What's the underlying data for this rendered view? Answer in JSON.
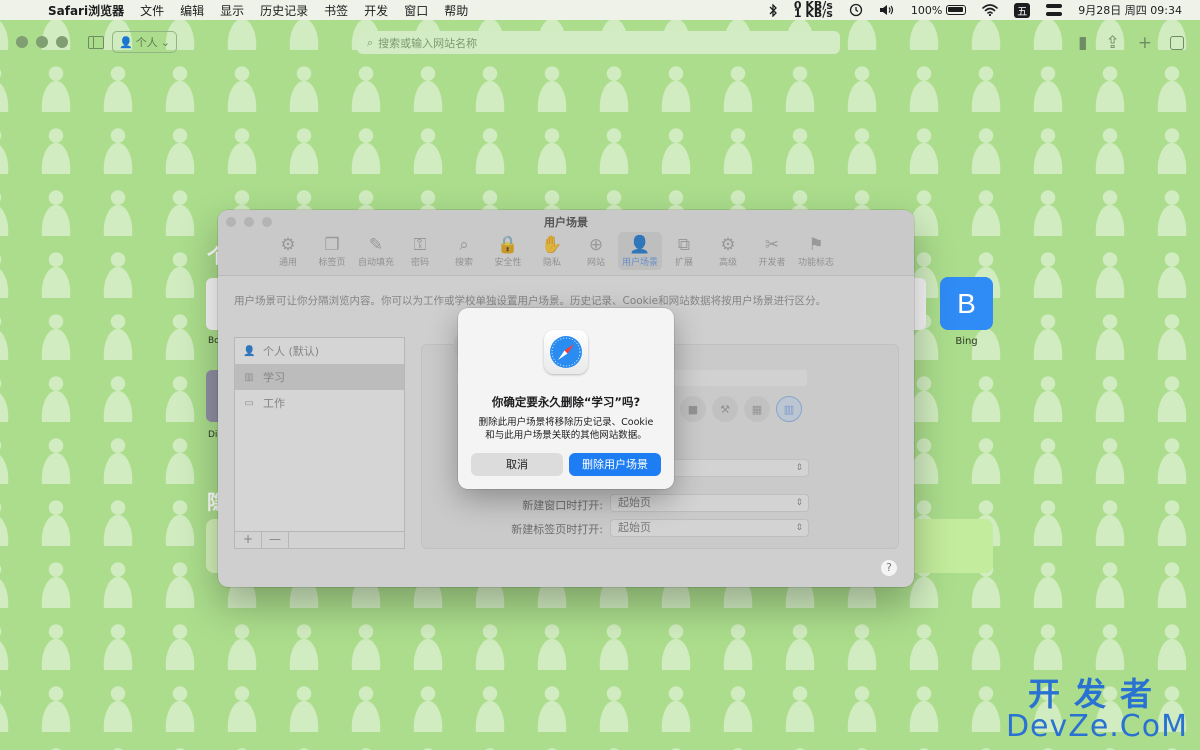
{
  "menubar": {
    "apple_glyph": "",
    "items": [
      "Safari浏览器",
      "文件",
      "编辑",
      "显示",
      "历史记录",
      "书签",
      "开发",
      "窗口",
      "帮助"
    ],
    "net_up": "0 KB/s",
    "net_down": "1 KB/s",
    "battery": "100%",
    "ime": "五",
    "datetime": "9月28日 周四  09:34"
  },
  "toolbar": {
    "profile_label": "个人",
    "address_placeholder": "搜索或输入网站名称"
  },
  "start_page": {
    "bing_letter": "B",
    "bing_label": "Bing"
  },
  "settings": {
    "title": "用户场景",
    "tabs": [
      {
        "label": "通用",
        "icon": "⚙"
      },
      {
        "label": "标签页",
        "icon": "❐"
      },
      {
        "label": "自动填充",
        "icon": "✎"
      },
      {
        "label": "密码",
        "icon": "⚿"
      },
      {
        "label": "搜索",
        "icon": "⌕"
      },
      {
        "label": "安全性",
        "icon": "🔒"
      },
      {
        "label": "隐私",
        "icon": "✋"
      },
      {
        "label": "网站",
        "icon": "⊕"
      },
      {
        "label": "用户场景",
        "icon": "👤"
      },
      {
        "label": "扩展",
        "icon": "⧉"
      },
      {
        "label": "高级",
        "icon": "⚙"
      },
      {
        "label": "开发者",
        "icon": "✂"
      },
      {
        "label": "功能标志",
        "icon": "⚑"
      }
    ],
    "description": "用户场景可让你分隔浏览内容。你可以为工作或学校单独设置用户场景。历史记录、Cookie和网站数据将按用户场景进行区分。",
    "profiles": [
      {
        "label": "个人 (默认)",
        "icon": "👤"
      },
      {
        "label": "学习",
        "icon": "▥"
      },
      {
        "label": "工作",
        "icon": "▭"
      }
    ],
    "list_add": "+",
    "list_remove": "—",
    "extensions_tab": "扩展",
    "new_window_label": "新建窗口时打开:",
    "new_window_value": "起始页",
    "new_tab_label": "新建标签页时打开:",
    "new_tab_value": "起始页",
    "help": "?"
  },
  "alert": {
    "title": "你确定要永久删除“学习”吗?",
    "message": "删除此用户场景将移除历史记录、Cookie和与此用户场景关联的其他网站数据。",
    "cancel": "取消",
    "confirm": "删除用户场景"
  },
  "watermark": {
    "cn": "开发者",
    "en": "DevZe.CoM"
  },
  "colors": {
    "background": "#abdd8c",
    "accent": "#1e7df3",
    "bing": "#2f8bf5"
  }
}
